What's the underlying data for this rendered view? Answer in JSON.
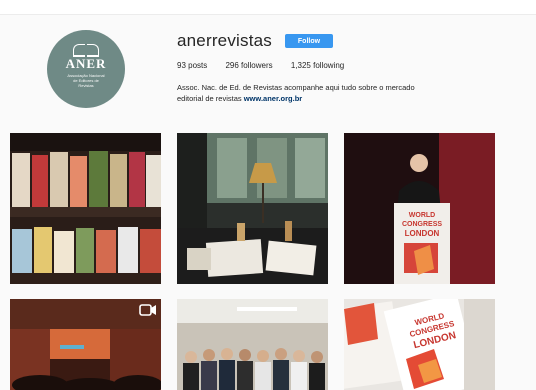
{
  "profile": {
    "username": "anerrevistas",
    "follow_label": "Follow",
    "stats": {
      "posts": "93 posts",
      "followers": "296 followers",
      "following": "1,325 following"
    },
    "bio_line1": "Assoc. Nac. de Ed. de Revistas acompanhe aqui tudo sobre o mercado",
    "bio_line2": "editorial de revistas",
    "bio_link": "www.aner.org.br",
    "avatar": {
      "logo_text": "ANER",
      "logo_subtitle": "Associação Nacional de Editores de Revistas",
      "background": "#6f8a86"
    }
  },
  "posts": [
    {
      "kind": "magazine-rack-photo"
    },
    {
      "kind": "table-with-magazines-photo"
    },
    {
      "kind": "speaker-at-podium-photo",
      "podium_lines": [
        "WORLD",
        "CONGRESS",
        "LONDON"
      ]
    },
    {
      "kind": "auditorium-video",
      "icon": "video-icon"
    },
    {
      "kind": "group-photo"
    },
    {
      "kind": "congress-magazines-photo",
      "cover_lines": [
        "WORLD",
        "CONGRESS",
        "LONDON"
      ]
    }
  ],
  "colors": {
    "follow": "#3897f0",
    "link": "#003569",
    "text": "#262626"
  }
}
